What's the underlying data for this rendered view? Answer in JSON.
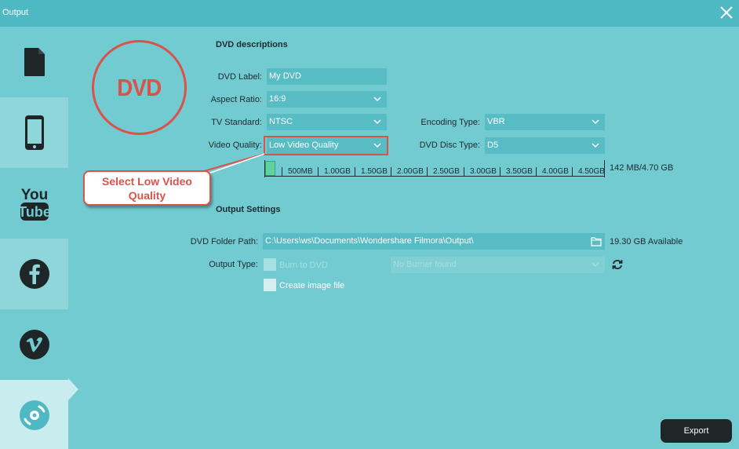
{
  "window": {
    "title": "Output"
  },
  "sidebar": {
    "items": [
      {
        "name": "local-file",
        "icon": "file-icon"
      },
      {
        "name": "device",
        "icon": "phone-icon"
      },
      {
        "name": "youtube",
        "icon": "youtube-icon"
      },
      {
        "name": "facebook",
        "icon": "facebook-icon"
      },
      {
        "name": "vimeo",
        "icon": "vimeo-icon"
      },
      {
        "name": "dvd",
        "icon": "disc-icon",
        "active": true
      }
    ]
  },
  "dvd_logo": {
    "text": "DVD"
  },
  "dvd_descriptions": {
    "title": "DVD descriptions",
    "label_label": "DVD Label:",
    "label_value": "My DVD",
    "aspect_label": "Aspect Ratio:",
    "aspect_value": "16:9",
    "tv_label": "TV Standard:",
    "tv_value": "NTSC",
    "quality_label": "Video Quality:",
    "quality_value": "Low Video Quality",
    "encoding_label": "Encoding Type:",
    "encoding_value": "VBR",
    "disc_label": "DVD Disc Type:",
    "disc_value": "D5"
  },
  "size_bar": {
    "ticks": [
      "500MB",
      "1.00GB",
      "1.50GB",
      "2.00GB",
      "2.50GB",
      "3.00GB",
      "3.50GB",
      "4.00GB",
      "4.50GB"
    ],
    "used_fraction": 0.03,
    "summary": "142 MB/4.70 GB"
  },
  "callout": {
    "line1": "Select Low Video",
    "line2": "Quality"
  },
  "output_settings": {
    "title": "Output Settings",
    "folder_label": "DVD Folder Path:",
    "folder_value": "C:\\Users\\ws\\Documents\\Wondershare Filmora\\Output\\",
    "available": "19.30 GB Available",
    "type_label": "Output Type:",
    "burn_label": "Burn to DVD",
    "burner_value": "No Burner found",
    "image_label": "Create image file"
  },
  "export": {
    "label": "Export"
  },
  "colors": {
    "accent": "#d9534a",
    "field": "#58bcc4",
    "background": "#72cbd1"
  }
}
